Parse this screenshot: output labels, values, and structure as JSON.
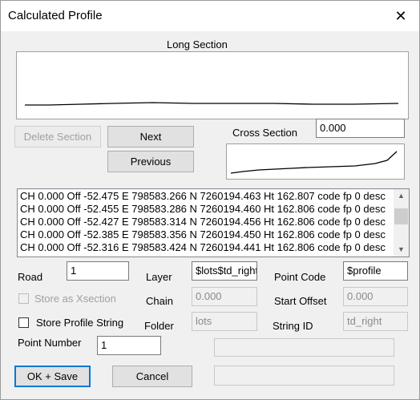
{
  "window": {
    "title": "Calculated Profile",
    "close_glyph": "✕"
  },
  "long_section": {
    "label": "Long Section"
  },
  "cross_section": {
    "label": "Cross Section",
    "value": "0.000"
  },
  "buttons": {
    "delete_section": "Delete Section",
    "next": "Next",
    "previous": "Previous",
    "ok_save": "OK + Save",
    "cancel": "Cancel"
  },
  "points": [
    "CH     0.000 Off  -52.475 E  798583.266 N 7260194.463 Ht  162.807 code  fp 0 desc",
    "CH     0.000 Off  -52.455 E  798583.286 N 7260194.460 Ht  162.806 code  fp 0 desc",
    "CH     0.000 Off  -52.427 E  798583.314 N 7260194.456 Ht  162.806 code  fp 0 desc",
    "CH     0.000 Off  -52.385 E  798583.356 N 7260194.450 Ht  162.806 code  fp 0 desc",
    "CH     0.000 Off  -52.316 E  798583.424 N 7260194.441 Ht  162.806 code  fp 0 desc"
  ],
  "form": {
    "road_label": "Road",
    "road_value": "1",
    "layer_label": "Layer",
    "layer_value": "$lots$td_right",
    "point_code_label": "Point Code",
    "point_code_value": "$profile",
    "store_xsection_label": "Store as Xsection",
    "chain_label": "Chain",
    "chain_value": "0.000",
    "start_offset_label": "Start Offset",
    "start_offset_value": "0.000",
    "store_profile_label": "Store Profile String",
    "folder_label": "Folder",
    "folder_value": "lots",
    "string_id_label": "String ID",
    "string_id_value": "td_right",
    "point_number_label": "Point Number",
    "point_number_value": "1",
    "status_1": "",
    "status_2": ""
  },
  "icons": {
    "scroll_up": "up-arrow-icon",
    "scroll_down": "down-arrow-icon"
  }
}
